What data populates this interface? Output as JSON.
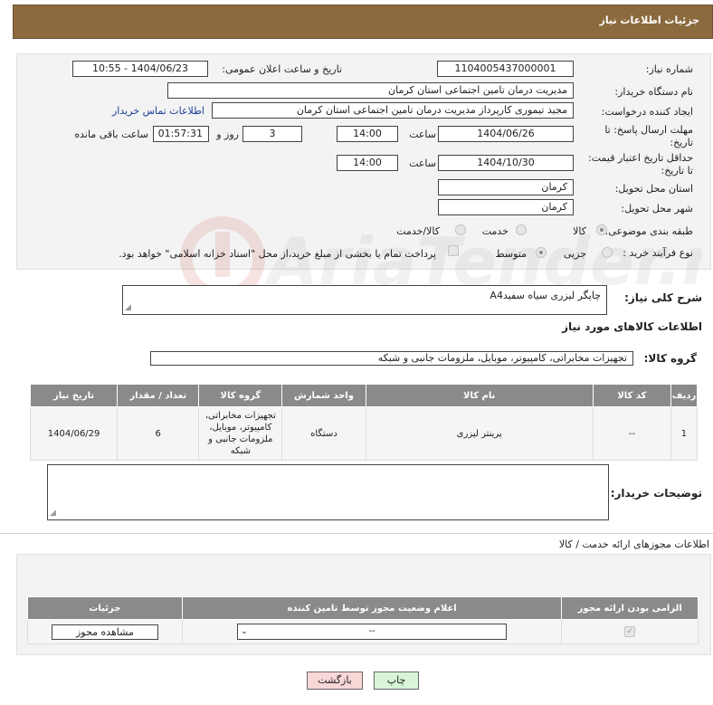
{
  "header": {
    "title": "جزئیات اطلاعات نیاز"
  },
  "fields": {
    "need_number_label": "شماره نیاز:",
    "need_number": "1104005437000001",
    "announce_label": "تاریخ و ساعت اعلان عمومی:",
    "announce_value": "1404/06/23 - 10:55",
    "buyer_org_label": "نام دستگاه خریدار:",
    "buyer_org": "مدیریت درمان تامین اجتماعی استان کرمان",
    "requester_label": "ایجاد کننده درخواست:",
    "requester": "مجید تیموری کارپرداز مدیریت درمان تامین اجتماعی استان کرمان",
    "contact_link": "اطلاعات تماس خریدار",
    "deadline_label": "مهلت ارسال پاسخ: تا تاریخ:",
    "deadline_date": "1404/06/26",
    "time_label": "ساعت",
    "deadline_time": "14:00",
    "days_value": "3",
    "days_label": "روز و",
    "remaining_time": "01:57:31",
    "remaining_label": "ساعت باقی مانده",
    "validity_label": "حداقل تاریخ اعتبار قیمت: تا تاریخ:",
    "validity_date": "1404/10/30",
    "validity_time": "14:00",
    "province_label": "استان محل تحویل:",
    "province": "کرمان",
    "city_label": "شهر محل تحویل:",
    "city": "کرمان",
    "category_label": "طبقه بندی موضوعی:",
    "category_options": [
      "کالا",
      "خدمت",
      "کالا/خدمت"
    ],
    "process_label": "نوع فرآیند خرید :",
    "process_options": [
      "جزیی",
      "متوسط"
    ],
    "payment_note": "پرداخت تمام یا بخشی از مبلغ خرید،از محل \"اسناد خزانه اسلامی\" خواهد بود."
  },
  "description": {
    "label": "شرح کلی نیاز:",
    "value": "چاپگر لیزری سیاه سفیدA4"
  },
  "goods": {
    "section_title": "اطلاعات کالاهای مورد نیاز",
    "group_label": "گروه کالا:",
    "group_value": "تجهیزات مخابراتی، کامپیوتر، موبایل، ملزومات جانبی و شبکه",
    "columns": [
      "ردیف",
      "کد کالا",
      "نام کالا",
      "واحد شمارش",
      "گروه کالا",
      "تعداد / مقدار",
      "تاریخ نیاز"
    ],
    "rows": [
      {
        "row": "1",
        "code": "--",
        "name": "پرینتر لیزری",
        "unit": "دستگاه",
        "group": "تجهیزات مخابراتی، کامپیوتر، موبایل، ملزومات جانبی و شبکه",
        "qty": "6",
        "date": "1404/06/29"
      }
    ]
  },
  "buyer_notes": {
    "label": "توضیحات خریدار:",
    "value": ""
  },
  "permits": {
    "section_title": "اطلاعات مجوزهای ارائه خدمت / کالا",
    "columns": [
      "الزامی بودن ارائه مجوز",
      "اعلام وضعیت مجوز توسط تامین کننده",
      "جزئیات"
    ],
    "select_value": "--",
    "view_button": "مشاهده مجوز"
  },
  "actions": {
    "print": "چاپ",
    "back": "بازگشت"
  },
  "watermark": "AriaTender.neT",
  "colors": {
    "header": "#8b6a3e",
    "table_header": "#8a8a8a",
    "link": "#1a3d99",
    "back_button": "#f8d7d7",
    "print_button": "#d9f5d9"
  }
}
